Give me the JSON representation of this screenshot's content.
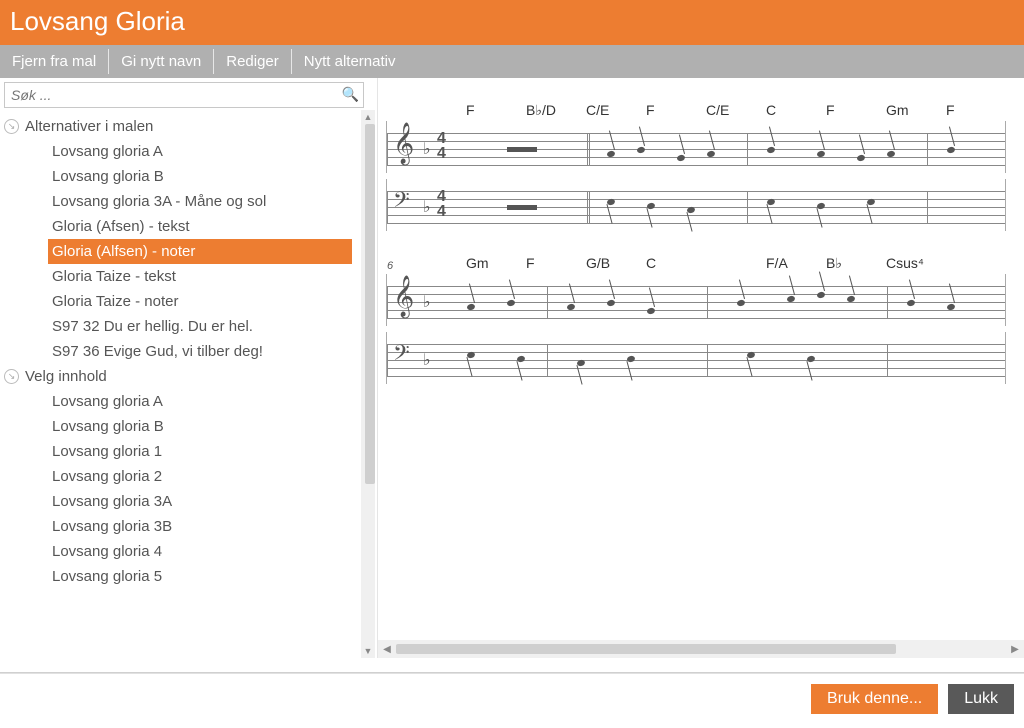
{
  "header": {
    "title": "Lovsang Gloria"
  },
  "toolbar": {
    "items": [
      {
        "label": "Fjern fra mal"
      },
      {
        "label": "Gi nytt navn"
      },
      {
        "label": "Rediger"
      },
      {
        "label": "Nytt alternativ"
      }
    ]
  },
  "search": {
    "placeholder": "Søk ..."
  },
  "groups": [
    {
      "title": "Alternativer i malen",
      "items": [
        {
          "label": "Lovsang gloria A",
          "selected": false
        },
        {
          "label": "Lovsang gloria B",
          "selected": false
        },
        {
          "label": "Lovsang gloria 3A - Måne og sol",
          "selected": false
        },
        {
          "label": "Gloria (Afsen) - tekst",
          "selected": false
        },
        {
          "label": "Gloria (Alfsen) - noter",
          "selected": true
        },
        {
          "label": "Gloria Taize - tekst",
          "selected": false
        },
        {
          "label": "Gloria Taize - noter",
          "selected": false
        },
        {
          "label": "S97 32 Du er hellig. Du er hel.",
          "selected": false
        },
        {
          "label": "S97 36 Evige Gud, vi tilber deg!",
          "selected": false
        }
      ]
    },
    {
      "title": "Velg innhold",
      "items": [
        {
          "label": "Lovsang gloria A",
          "selected": false
        },
        {
          "label": "Lovsang gloria B",
          "selected": false
        },
        {
          "label": "Lovsang gloria 1",
          "selected": false
        },
        {
          "label": "Lovsang gloria 2",
          "selected": false
        },
        {
          "label": "Lovsang gloria 3A",
          "selected": false
        },
        {
          "label": "Lovsang gloria 3B",
          "selected": false
        },
        {
          "label": "Lovsang gloria 4",
          "selected": false
        },
        {
          "label": "Lovsang gloria 5",
          "selected": false
        }
      ]
    }
  ],
  "sheet": {
    "systems": [
      {
        "measure_start": "",
        "chords_top": [
          "F",
          "B♭/D",
          "C/E",
          "F",
          "C/E",
          "C",
          "F",
          "Gm",
          "F"
        ]
      },
      {
        "measure_start": "6",
        "chords_top": [
          "Gm",
          "F",
          "G/B",
          "C",
          "",
          "F/A",
          "B♭",
          "Csus⁴",
          ""
        ]
      }
    ],
    "time_signature": {
      "top": "4",
      "bottom": "4"
    }
  },
  "footer": {
    "use_label": "Bruk denne...",
    "close_label": "Lukk"
  }
}
